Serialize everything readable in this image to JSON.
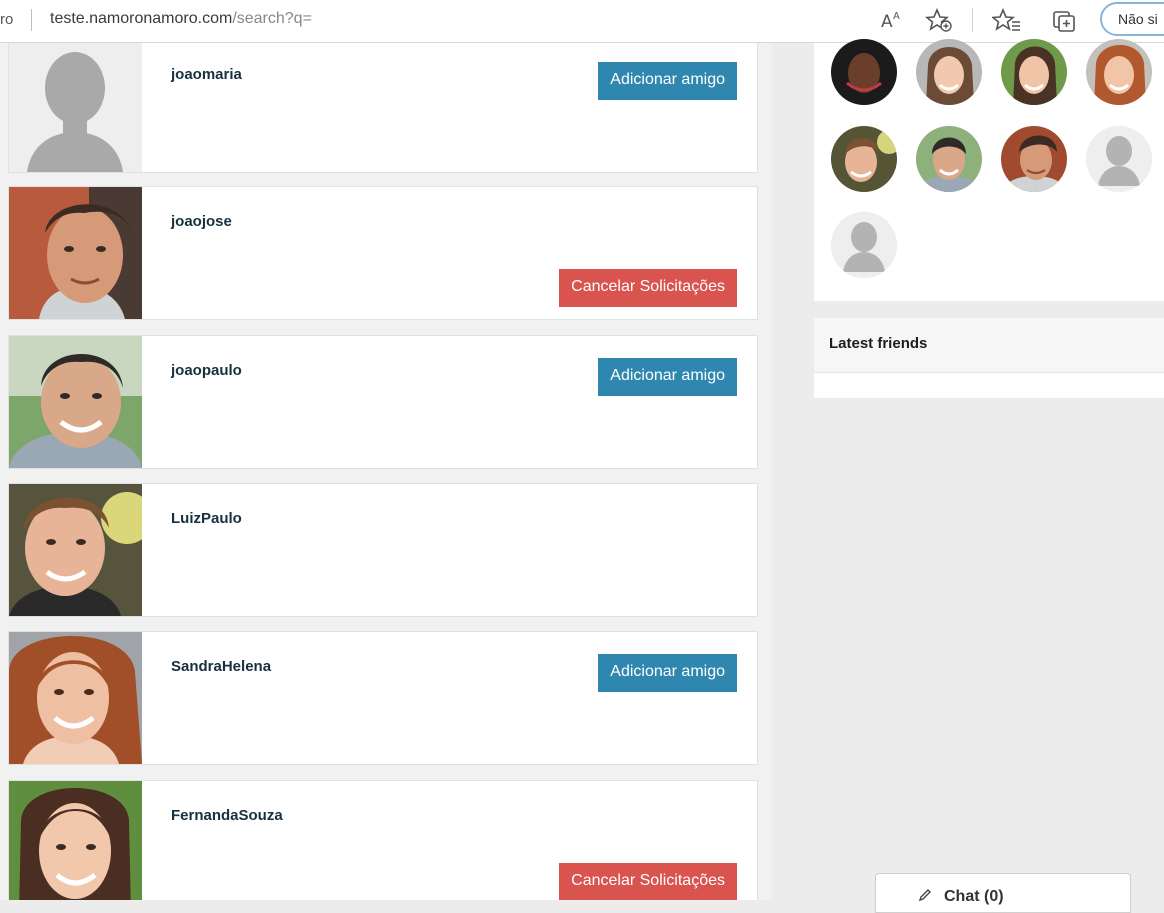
{
  "browser": {
    "tab_fragment": "ro",
    "url_host": "teste.namoronamoro.com",
    "url_path": "/search?q=",
    "signin_label": "Não si"
  },
  "results": [
    {
      "username": "joaomaria",
      "action": "Adicionar amigo"
    },
    {
      "username": "joaojose",
      "action": "Cancelar Solicitações"
    },
    {
      "username": "joaopaulo",
      "action": "Adicionar amigo"
    },
    {
      "username": "LuizPaulo",
      "action": ""
    },
    {
      "username": "SandraHelena",
      "action": "Adicionar amigo"
    },
    {
      "username": "FernandaSouza",
      "action": "Cancelar Solicitações"
    }
  ],
  "sidebar": {
    "latest_friends_title": "Latest friends",
    "chat_label": "Chat (0)"
  },
  "colors": {
    "add_button": "#2f87b0",
    "cancel_button": "#d9534f"
  }
}
